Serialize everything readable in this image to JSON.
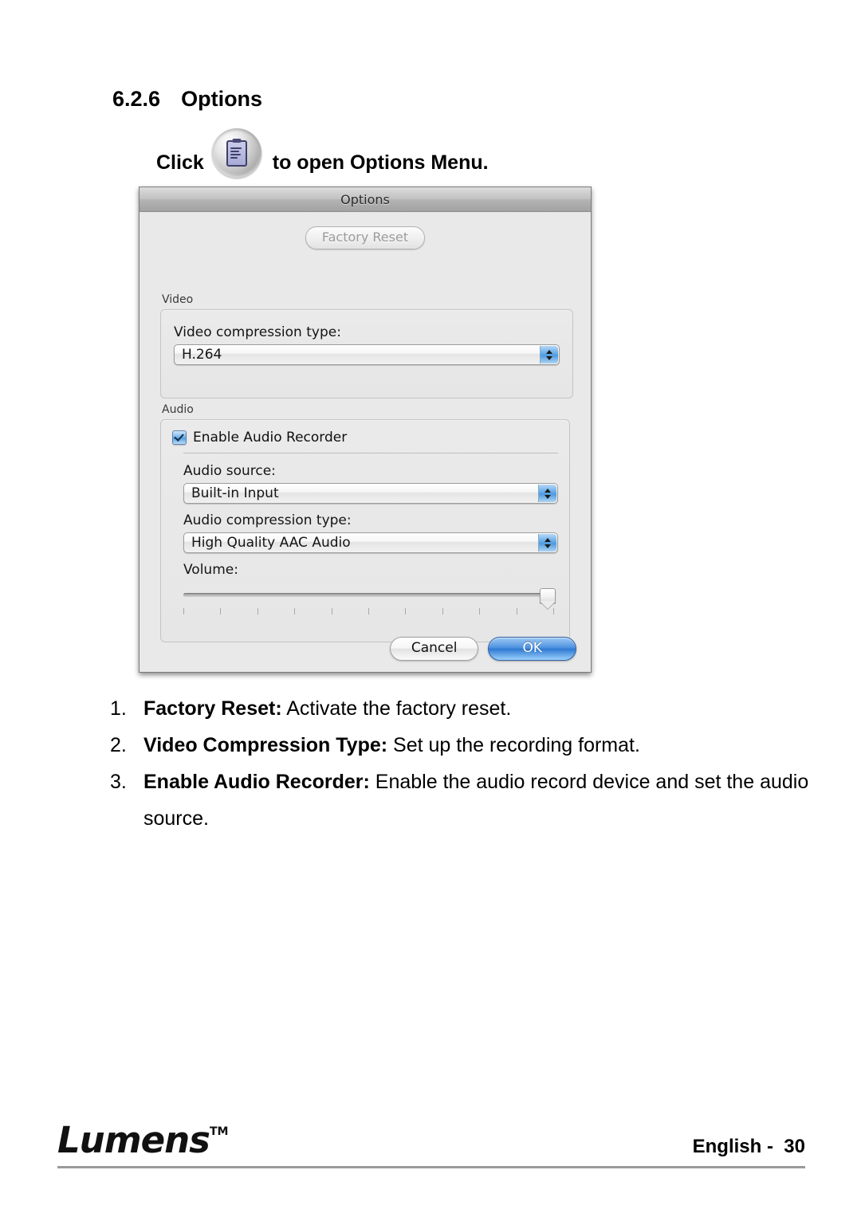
{
  "document": {
    "heading_number": "6.2.6",
    "heading_title": "Options",
    "click_lead": "Click",
    "click_trail": "to open Options Menu.",
    "options_icon_name": "options-clipboard-icon"
  },
  "dialog": {
    "title": "Options",
    "factory_reset_label": "Factory Reset",
    "video": {
      "group_label": "Video",
      "compression_label": "Video compression type:",
      "compression_value": "H.264"
    },
    "audio": {
      "group_label": "Audio",
      "enable_recorder_label": "Enable Audio Recorder",
      "enable_recorder_checked": true,
      "source_label": "Audio source:",
      "source_value": "Built-in Input",
      "compression_label": "Audio compression type:",
      "compression_value": "High Quality AAC Audio",
      "volume_label": "Volume:",
      "volume_percent": 100,
      "volume_tick_count": 11
    },
    "buttons": {
      "cancel_label": "Cancel",
      "ok_label": "OK"
    },
    "colors": {
      "accent_blue": "#4f9ade",
      "ok_button_blue": "#2f7ad2",
      "dialog_background": "#e9e9e9",
      "titlebar_gray": "#b4b4b4"
    }
  },
  "notes": [
    {
      "marker": "1.",
      "term": "Factory Reset:",
      "text": " Activate the factory reset."
    },
    {
      "marker": "2.",
      "term": "Video Compression Type:",
      "text": " Set up the recording format."
    },
    {
      "marker": "3.",
      "term": "Enable Audio Recorder:",
      "text": " Enable the audio record device and set the audio source."
    }
  ],
  "footer": {
    "logo_text": "Lumens",
    "logo_tm": "TM",
    "page_text": "English -  30"
  }
}
